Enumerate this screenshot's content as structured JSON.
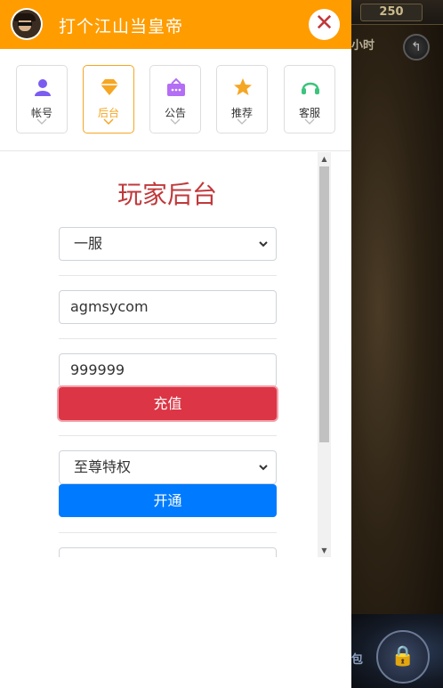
{
  "header": {
    "title": "打个江山当皇帝",
    "close_label": "✕"
  },
  "nav": {
    "items": [
      {
        "label": "帐号",
        "icon": "account-icon",
        "active": false
      },
      {
        "label": "后台",
        "icon": "diamond-icon",
        "active": true
      },
      {
        "label": "公告",
        "icon": "notice-icon",
        "active": false
      },
      {
        "label": "推荐",
        "icon": "star-icon",
        "active": false
      },
      {
        "label": "客服",
        "icon": "headset-icon",
        "active": false
      }
    ]
  },
  "main": {
    "title": "玩家后台",
    "server_select": {
      "selected": "一服"
    },
    "account_input": {
      "value": "agmsycom"
    },
    "amount_input": {
      "value": "999999"
    },
    "recharge_button": "充值",
    "privilege_select": {
      "selected": "至尊特权"
    },
    "activate_button": "开通"
  },
  "game": {
    "top_number": "250",
    "hour_text": "小时",
    "side_text": "包"
  },
  "colors": {
    "header": "#ff9c00",
    "title": "#c0393b",
    "recharge": "#dc3545",
    "activate": "#007bff",
    "active_nav": "#f5a623"
  }
}
